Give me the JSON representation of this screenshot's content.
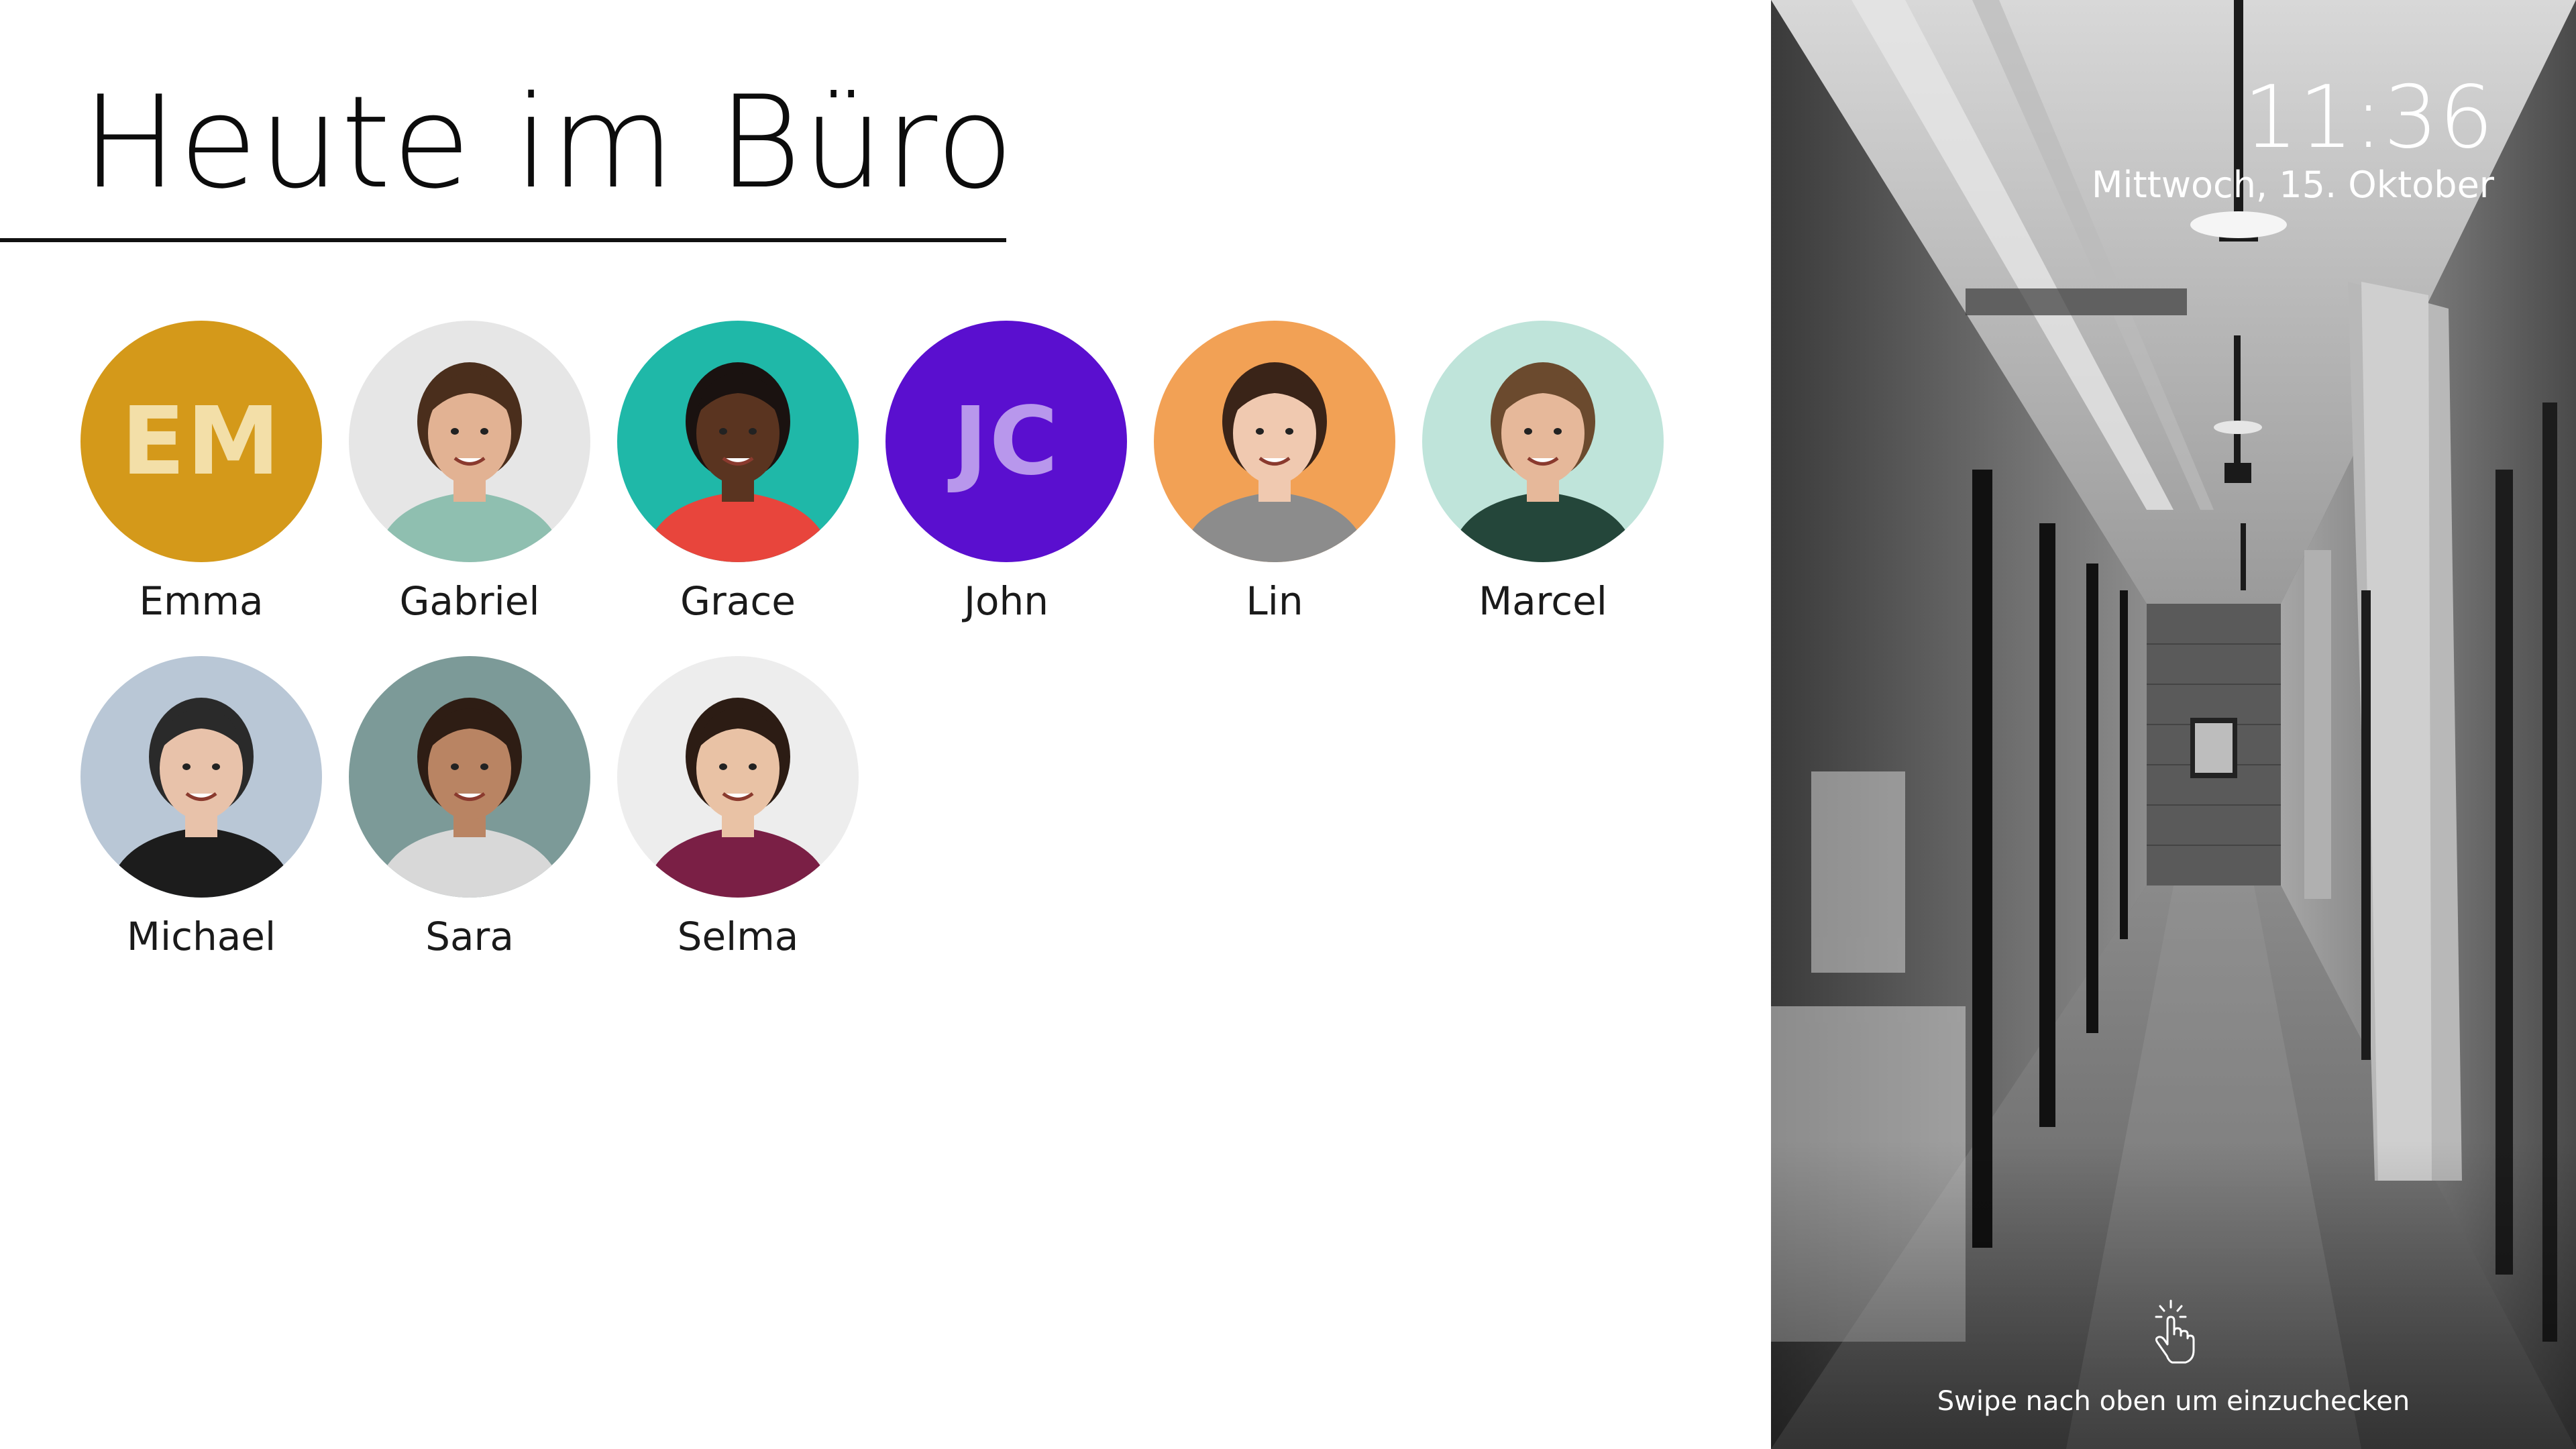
{
  "page": {
    "title": "Heute im Büro"
  },
  "people": [
    {
      "name": "Emma",
      "initials": "EM",
      "type": "initials",
      "bg": "#d4991a",
      "fg": "#f3dfa8"
    },
    {
      "name": "Gabriel",
      "type": "photo",
      "photo_bg": "#e6e6e6",
      "skin": "#e2b293",
      "hair": "#4a2e1c",
      "shirt": "#8fbfb0"
    },
    {
      "name": "Grace",
      "type": "photo",
      "photo_bg": "#1fb8a8",
      "skin": "#5a3420",
      "hair": "#1a1210",
      "shirt": "#e8453c"
    },
    {
      "name": "John",
      "initials": "JC",
      "type": "initials",
      "bg": "#5a0fcf",
      "fg": "#b897ec"
    },
    {
      "name": "Lin",
      "type": "photo",
      "photo_bg": "#f2a155",
      "skin": "#f0c9b0",
      "hair": "#3a2418",
      "shirt": "#8c8c8c"
    },
    {
      "name": "Marcel",
      "type": "photo",
      "photo_bg": "#bfe4da",
      "skin": "#e6b89a",
      "hair": "#6b4a2e",
      "shirt": "#24463a"
    },
    {
      "name": "Michael",
      "type": "photo",
      "photo_bg": "#b9c7d6",
      "skin": "#e8c2aa",
      "hair": "#2a2a2a",
      "shirt": "#1c1c1c"
    },
    {
      "name": "Sara",
      "type": "photo",
      "photo_bg": "#7c9a98",
      "skin": "#b98463",
      "hair": "#2e1d14",
      "shirt": "#d8d8d8"
    },
    {
      "name": "Selma",
      "type": "photo",
      "photo_bg": "#ededed",
      "skin": "#e9c2a5",
      "hair": "#2c1c14",
      "shirt": "#7a1f45"
    }
  ],
  "status": {
    "time": "11:36",
    "date": "Mittwoch, 15. Oktober"
  },
  "checkin": {
    "hint": "Swipe nach oben um einzuchecken",
    "icon": "swipe-up-hand-icon"
  },
  "background": {
    "icon": "office-corridor-photo"
  }
}
